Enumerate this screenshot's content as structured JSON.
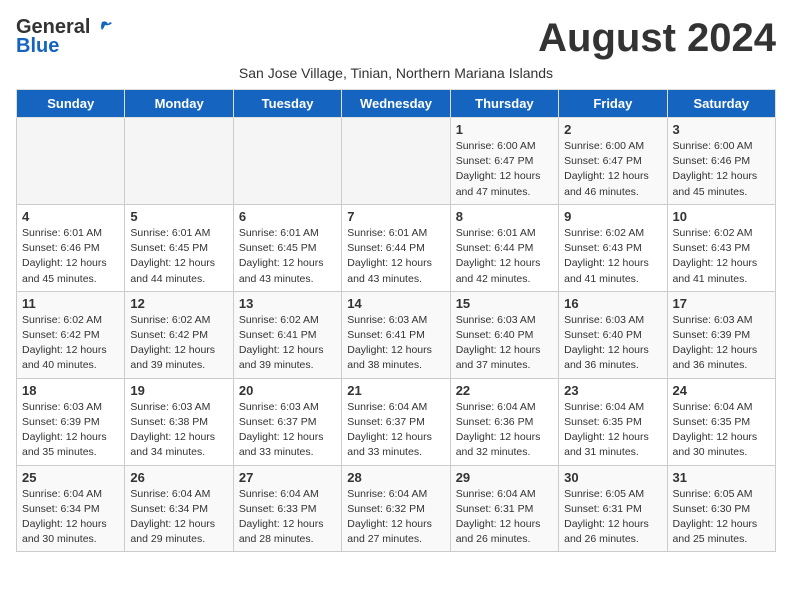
{
  "header": {
    "logo_general": "General",
    "logo_blue": "Blue",
    "month_title": "August 2024",
    "subtitle": "San Jose Village, Tinian, Northern Mariana Islands"
  },
  "days_of_week": [
    "Sunday",
    "Monday",
    "Tuesday",
    "Wednesday",
    "Thursday",
    "Friday",
    "Saturday"
  ],
  "weeks": [
    [
      {
        "day": "",
        "info": ""
      },
      {
        "day": "",
        "info": ""
      },
      {
        "day": "",
        "info": ""
      },
      {
        "day": "",
        "info": ""
      },
      {
        "day": "1",
        "info": "Sunrise: 6:00 AM\nSunset: 6:47 PM\nDaylight: 12 hours\nand 47 minutes."
      },
      {
        "day": "2",
        "info": "Sunrise: 6:00 AM\nSunset: 6:47 PM\nDaylight: 12 hours\nand 46 minutes."
      },
      {
        "day": "3",
        "info": "Sunrise: 6:00 AM\nSunset: 6:46 PM\nDaylight: 12 hours\nand 45 minutes."
      }
    ],
    [
      {
        "day": "4",
        "info": "Sunrise: 6:01 AM\nSunset: 6:46 PM\nDaylight: 12 hours\nand 45 minutes."
      },
      {
        "day": "5",
        "info": "Sunrise: 6:01 AM\nSunset: 6:45 PM\nDaylight: 12 hours\nand 44 minutes."
      },
      {
        "day": "6",
        "info": "Sunrise: 6:01 AM\nSunset: 6:45 PM\nDaylight: 12 hours\nand 43 minutes."
      },
      {
        "day": "7",
        "info": "Sunrise: 6:01 AM\nSunset: 6:44 PM\nDaylight: 12 hours\nand 43 minutes."
      },
      {
        "day": "8",
        "info": "Sunrise: 6:01 AM\nSunset: 6:44 PM\nDaylight: 12 hours\nand 42 minutes."
      },
      {
        "day": "9",
        "info": "Sunrise: 6:02 AM\nSunset: 6:43 PM\nDaylight: 12 hours\nand 41 minutes."
      },
      {
        "day": "10",
        "info": "Sunrise: 6:02 AM\nSunset: 6:43 PM\nDaylight: 12 hours\nand 41 minutes."
      }
    ],
    [
      {
        "day": "11",
        "info": "Sunrise: 6:02 AM\nSunset: 6:42 PM\nDaylight: 12 hours\nand 40 minutes."
      },
      {
        "day": "12",
        "info": "Sunrise: 6:02 AM\nSunset: 6:42 PM\nDaylight: 12 hours\nand 39 minutes."
      },
      {
        "day": "13",
        "info": "Sunrise: 6:02 AM\nSunset: 6:41 PM\nDaylight: 12 hours\nand 39 minutes."
      },
      {
        "day": "14",
        "info": "Sunrise: 6:03 AM\nSunset: 6:41 PM\nDaylight: 12 hours\nand 38 minutes."
      },
      {
        "day": "15",
        "info": "Sunrise: 6:03 AM\nSunset: 6:40 PM\nDaylight: 12 hours\nand 37 minutes."
      },
      {
        "day": "16",
        "info": "Sunrise: 6:03 AM\nSunset: 6:40 PM\nDaylight: 12 hours\nand 36 minutes."
      },
      {
        "day": "17",
        "info": "Sunrise: 6:03 AM\nSunset: 6:39 PM\nDaylight: 12 hours\nand 36 minutes."
      }
    ],
    [
      {
        "day": "18",
        "info": "Sunrise: 6:03 AM\nSunset: 6:39 PM\nDaylight: 12 hours\nand 35 minutes."
      },
      {
        "day": "19",
        "info": "Sunrise: 6:03 AM\nSunset: 6:38 PM\nDaylight: 12 hours\nand 34 minutes."
      },
      {
        "day": "20",
        "info": "Sunrise: 6:03 AM\nSunset: 6:37 PM\nDaylight: 12 hours\nand 33 minutes."
      },
      {
        "day": "21",
        "info": "Sunrise: 6:04 AM\nSunset: 6:37 PM\nDaylight: 12 hours\nand 33 minutes."
      },
      {
        "day": "22",
        "info": "Sunrise: 6:04 AM\nSunset: 6:36 PM\nDaylight: 12 hours\nand 32 minutes."
      },
      {
        "day": "23",
        "info": "Sunrise: 6:04 AM\nSunset: 6:35 PM\nDaylight: 12 hours\nand 31 minutes."
      },
      {
        "day": "24",
        "info": "Sunrise: 6:04 AM\nSunset: 6:35 PM\nDaylight: 12 hours\nand 30 minutes."
      }
    ],
    [
      {
        "day": "25",
        "info": "Sunrise: 6:04 AM\nSunset: 6:34 PM\nDaylight: 12 hours\nand 30 minutes."
      },
      {
        "day": "26",
        "info": "Sunrise: 6:04 AM\nSunset: 6:34 PM\nDaylight: 12 hours\nand 29 minutes."
      },
      {
        "day": "27",
        "info": "Sunrise: 6:04 AM\nSunset: 6:33 PM\nDaylight: 12 hours\nand 28 minutes."
      },
      {
        "day": "28",
        "info": "Sunrise: 6:04 AM\nSunset: 6:32 PM\nDaylight: 12 hours\nand 27 minutes."
      },
      {
        "day": "29",
        "info": "Sunrise: 6:04 AM\nSunset: 6:31 PM\nDaylight: 12 hours\nand 26 minutes."
      },
      {
        "day": "30",
        "info": "Sunrise: 6:05 AM\nSunset: 6:31 PM\nDaylight: 12 hours\nand 26 minutes."
      },
      {
        "day": "31",
        "info": "Sunrise: 6:05 AM\nSunset: 6:30 PM\nDaylight: 12 hours\nand 25 minutes."
      }
    ]
  ]
}
